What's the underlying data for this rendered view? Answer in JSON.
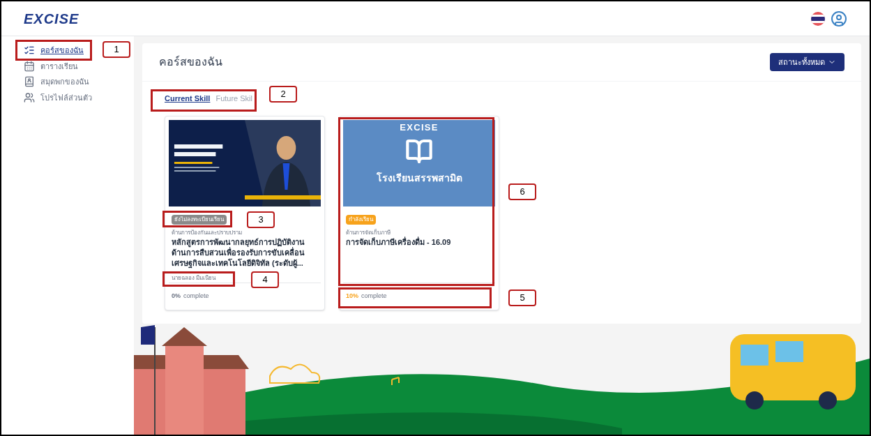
{
  "header": {
    "logo": "EXCISE"
  },
  "sidebar": {
    "items": [
      {
        "label": "คอร์สของฉัน",
        "selected": true
      },
      {
        "label": "ตารางเรียน",
        "selected": false
      },
      {
        "label": "สมุดพกของฉัน",
        "selected": false
      },
      {
        "label": "โปรไฟล์ส่วนตัว",
        "selected": false
      }
    ]
  },
  "panel": {
    "title": "คอร์สของฉัน",
    "filter_button": "สถานะทั้งหมด"
  },
  "tabs": [
    {
      "label": "Current Skill",
      "selected": true
    },
    {
      "label": "Future Skil",
      "selected": false
    }
  ],
  "courses": [
    {
      "status": {
        "kind": "not_enrolled",
        "label": "ยังไม่ลงทะเบียนเรียน"
      },
      "category": "ด้านการป้องกันและปราบปราม",
      "title": "หลักสูตรการพัฒนากลยุทธ์การปฏิบัติงานด้านการสืบสวนเพื่อรองรับการขับเคลื่อนเศรษฐกิจและเทคโนโลยีดิจิทัล (ระดับผู้...",
      "instructor": "นายฉลอง มีมเนียน",
      "percent": "0%",
      "complete": "complete"
    },
    {
      "cover": {
        "kind": "school",
        "logo": "EXCISE",
        "caption": "โรงเรียนสรรพสามิต"
      },
      "status": {
        "kind": "in_progress",
        "label": "กำลังเรียน"
      },
      "category": "ด้านการจัดเก็บภาษี",
      "title": "การจัดเก็บภาษีเครื่องดื่ม - 16.09",
      "percent": "10%",
      "complete": "complete"
    }
  ],
  "annotations": [
    {
      "label": "1"
    },
    {
      "label": "2"
    },
    {
      "label": "3"
    },
    {
      "label": "4"
    },
    {
      "label": "5"
    },
    {
      "label": "6"
    }
  ]
}
